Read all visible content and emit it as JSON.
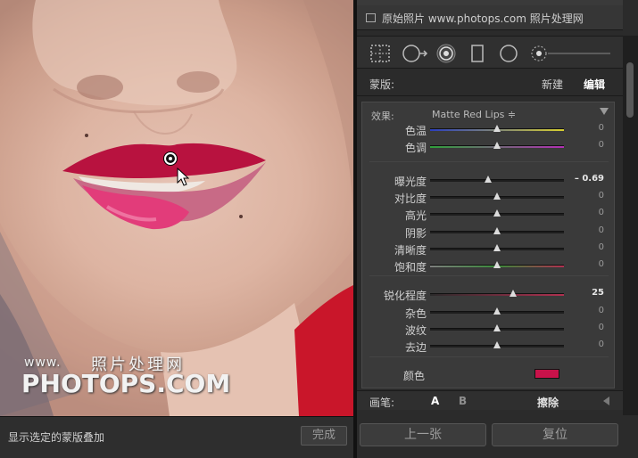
{
  "canvas": {
    "watermark_www": "www.",
    "watermark_cn": "照片处理网",
    "watermark_main": "PHOTOPS.COM"
  },
  "left_toolbar": {
    "overlay_label": "显示选定的蒙版叠加",
    "done_label": "完成"
  },
  "panel": {
    "original_photo_label": "原始照片 www.photops.com 照片处理网",
    "tools": [
      "crop-overlay-icon",
      "spot-removal-icon",
      "red-eye-icon",
      "graduated-filter-icon",
      "radial-filter-icon",
      "adjustment-brush-icon"
    ],
    "mask": {
      "label": "蒙版:",
      "new_label": "新建",
      "edit_label": "编辑"
    },
    "effect": {
      "label": "效果:",
      "preset": "Matte Red Lips ≑"
    },
    "sliders": [
      {
        "label": "色温",
        "value": "0",
        "position": 0.5,
        "gradient": "temp"
      },
      {
        "label": "色调",
        "value": "0",
        "position": 0.5,
        "gradient": "tint"
      },
      {
        "label": "曝光度",
        "value": "– 0.69",
        "position": 0.43,
        "active": true
      },
      {
        "label": "对比度",
        "value": "0",
        "position": 0.5
      },
      {
        "label": "高光",
        "value": "0",
        "position": 0.5
      },
      {
        "label": "阴影",
        "value": "0",
        "position": 0.5
      },
      {
        "label": "清晰度",
        "value": "0",
        "position": 0.5
      },
      {
        "label": "饱和度",
        "value": "0",
        "position": 0.5,
        "gradient": "sat"
      },
      {
        "label": "锐化程度",
        "value": "25",
        "position": 0.62,
        "active": true,
        "gradient": "sharp"
      },
      {
        "label": "杂色",
        "value": "0",
        "position": 0.5
      },
      {
        "label": "波纹",
        "value": "0",
        "position": 0.5
      },
      {
        "label": "去边",
        "value": "0",
        "position": 0.5
      }
    ],
    "color": {
      "label": "颜色",
      "swatch": "#c8124a"
    },
    "brush": {
      "label": "画笔:",
      "a_label": "A",
      "b_label": "B",
      "erase_label": "擦除"
    },
    "prev_label": "上一张",
    "reset_label": "复位"
  }
}
